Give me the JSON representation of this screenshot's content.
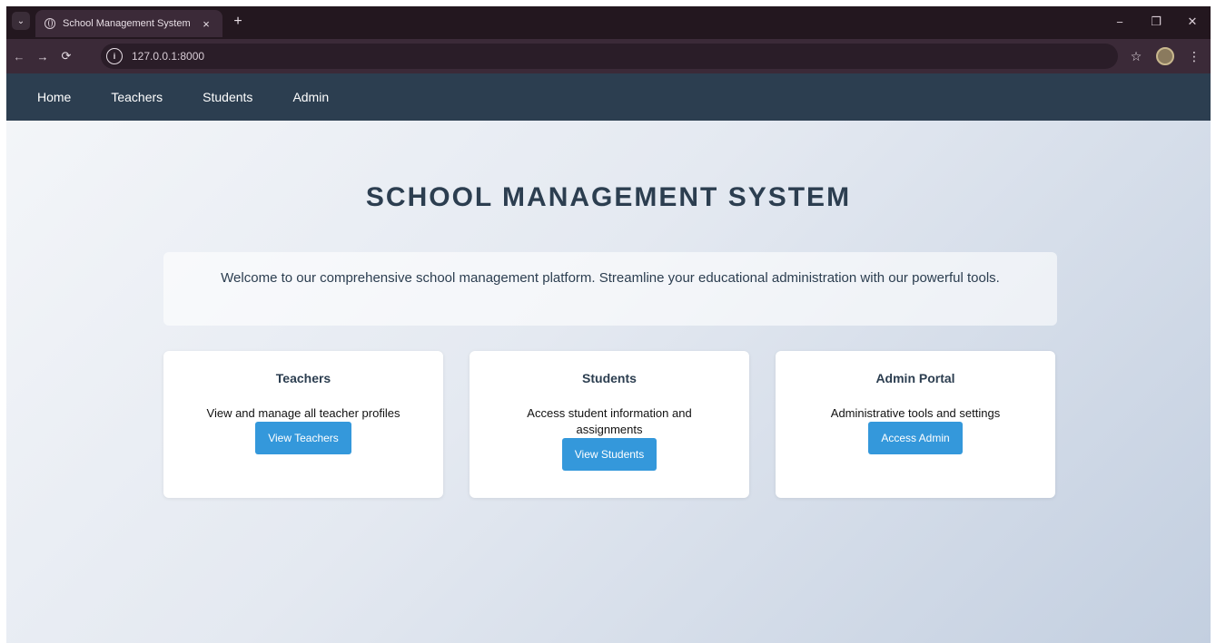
{
  "browser": {
    "tab_title": "School Management System",
    "tab_close": "×",
    "new_tab": "+",
    "url": "127.0.0.1:8000",
    "window_controls": {
      "minimize": "−",
      "restore": "❐",
      "close": "✕"
    },
    "nav": {
      "back": "←",
      "forward": "→",
      "reload": "⟳"
    },
    "icons": {
      "bookmark": "☆",
      "menu": "⋮",
      "site_info": "i",
      "tab_search": "⌄"
    }
  },
  "navbar": {
    "links": [
      "Home",
      "Teachers",
      "Students",
      "Admin"
    ]
  },
  "hero": {
    "title": "SCHOOL MANAGEMENT SYSTEM",
    "welcome": "Welcome to our comprehensive school management platform. Streamline your educational administration with our powerful tools."
  },
  "cards": [
    {
      "title": "Teachers",
      "description": "View and manage all teacher profiles",
      "button": "View Teachers"
    },
    {
      "title": "Students",
      "description": "Access student information and assignments",
      "button": "View Students"
    },
    {
      "title": "Admin Portal",
      "description": "Administrative tools and settings",
      "button": "Access Admin"
    }
  ],
  "colors": {
    "navbar": "#2c3e50",
    "button": "#3498db",
    "title": "#2c3e50"
  }
}
